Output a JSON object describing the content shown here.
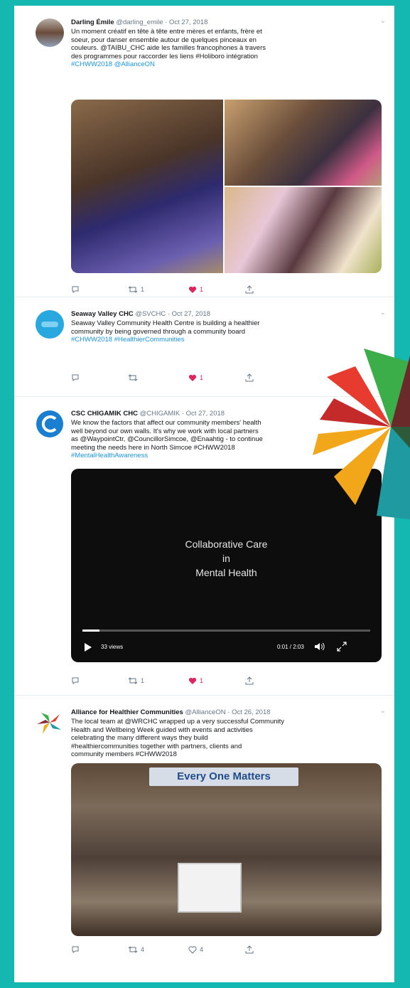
{
  "tweets": [
    {
      "name": "Darling Émile",
      "handle": "@darling_emile",
      "date": "Oct 27, 2018",
      "lines": [
        "Un moment créatif en tête à tête entre mères et enfants, frère et",
        "soeur, pour danser ensemble autour de quelques pinceaux en",
        "couleurs. @TAIBU_CHC aide les familles francophones à travers",
        "des programmes pour raccorder les liens #Holiboro intégration",
        "#CHWW2018 @AllianceON"
      ],
      "actions": {
        "reply": "",
        "retweet": "1",
        "like": "1"
      }
    },
    {
      "name": "Seaway Valley CHC",
      "handle": "@SVCHC",
      "date": "Oct 27, 2018",
      "lines": [
        "Seaway Valley Community Health Centre is building a healthier",
        "community by being governed through a community board",
        "#CHWW2018 #HealthierCommunities"
      ],
      "actions": {
        "reply": "",
        "retweet": "",
        "like": "1"
      }
    },
    {
      "name": "CSC CHIGAMIK CHC",
      "handle": "@CHIGAMIK",
      "date": "Oct 27, 2018",
      "lines": [
        "We know the factors that affect our community members' health",
        "well beyond our own walls. It's why we work with local partners",
        "as @WaypointCtr, @CouncillorSimcoe, @Enaahtig - to continue",
        "meeting the needs here in North Simcoe #CHWW2018",
        "#MentalHealthAwareness"
      ],
      "video": {
        "title_lines": [
          "Collaborative Care",
          "in",
          "Mental Health"
        ],
        "views": "33 views",
        "time": "0:01 / 2:03"
      },
      "actions": {
        "reply": "",
        "retweet": "1",
        "like": "1"
      }
    },
    {
      "name": "Alliance for Healthier Communities",
      "handle": "@AllianceON",
      "date": "Oct 26, 2018",
      "lines": [
        "The local team at @WRCHC wrapped up a very successful Community",
        "Health and Wellbeing Week guided with events and activities",
        "celebrating the many different ways they build",
        "#healthiercommunities together with partners, clients and",
        "community members #CHWW2018"
      ],
      "banner": "Every One Matters",
      "actions": {
        "reply": "",
        "retweet": "4",
        "like": "4"
      }
    }
  ],
  "colors": {
    "background": "#14b8b0",
    "link": "#1b95e0",
    "like": "#e0245e",
    "muted": "#657786"
  },
  "icons": [
    "reply-icon",
    "retweet-icon",
    "heart-icon",
    "share-icon",
    "play-icon",
    "volume-icon",
    "fullscreen-icon",
    "caret-down-icon"
  ]
}
